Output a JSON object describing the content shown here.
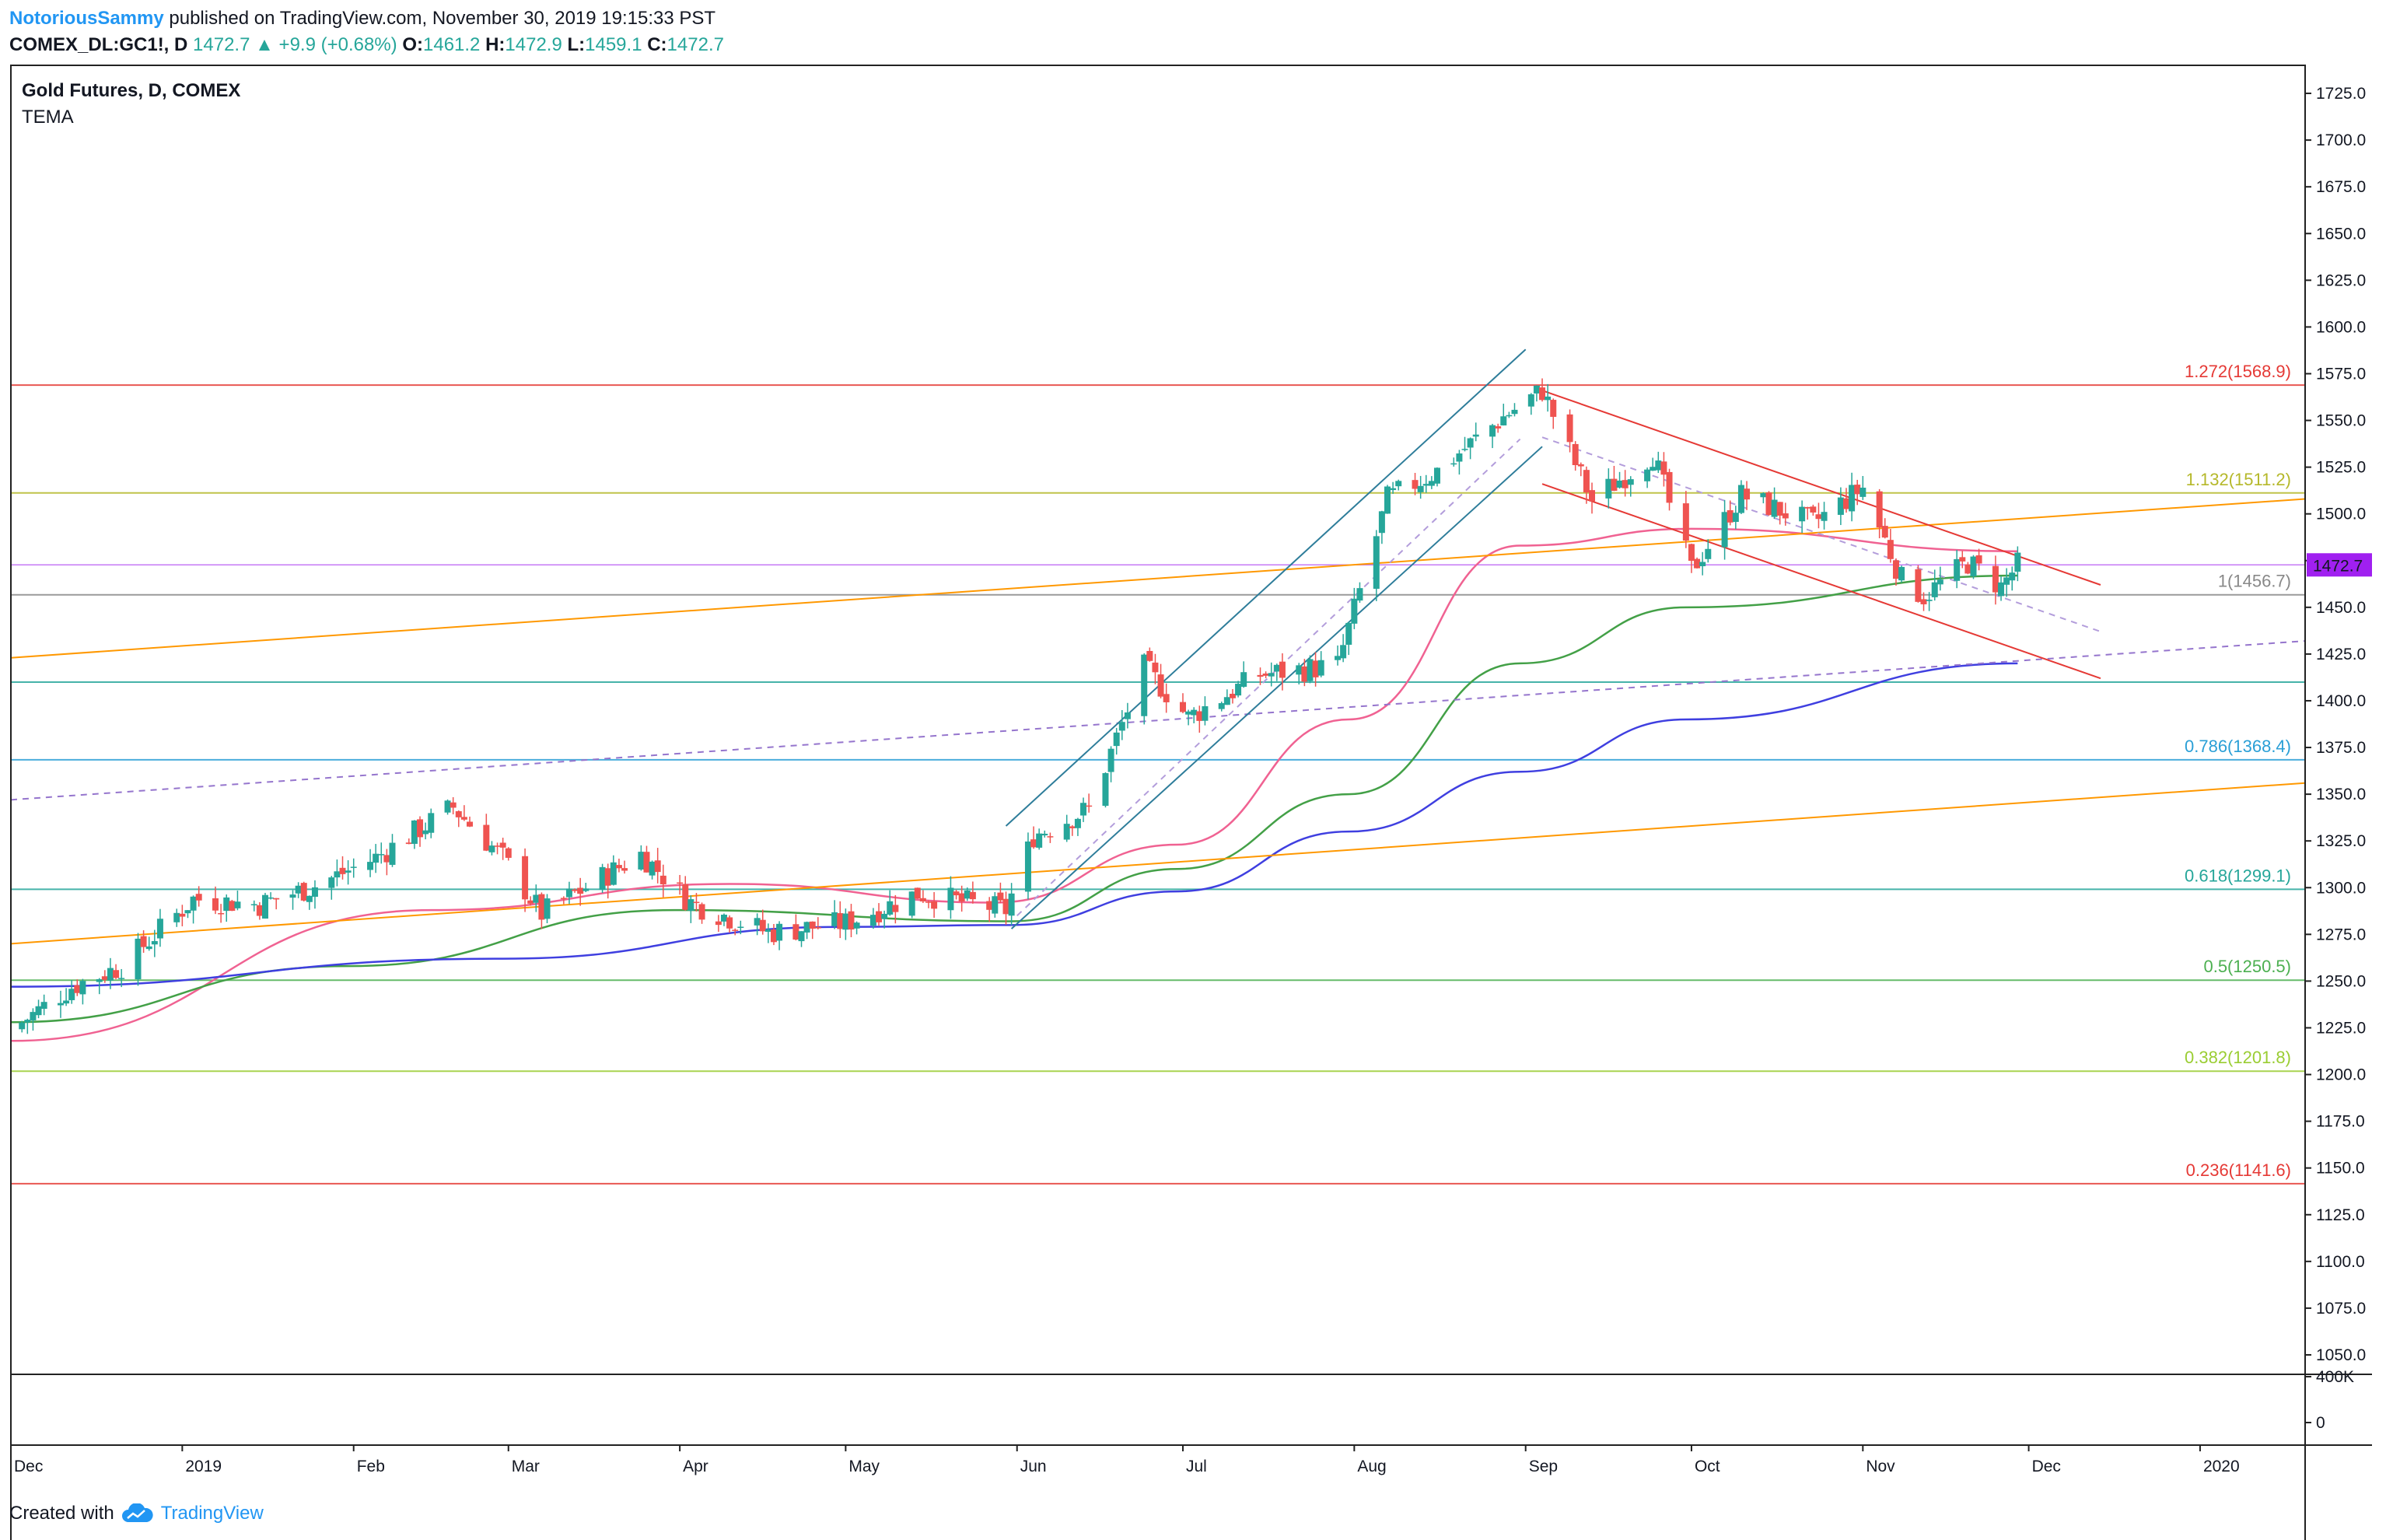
{
  "header": {
    "author": "NotoriousSammy",
    "published_text": "published on TradingView.com, November 30, 2019 19:15:33 PST",
    "symbol": "COMEX_DL:GC1!, D",
    "last": "1472.7",
    "change_arrow": "▲",
    "change": "+9.9 (+0.68%)",
    "o_label": "O:",
    "o_value": "1461.2",
    "h_label": "H:",
    "h_value": "1472.9",
    "l_label": "L:",
    "l_value": "1459.1",
    "c_label": "C:",
    "c_value": "1472.7"
  },
  "legend": {
    "title": "Gold Futures, D, COMEX",
    "indicator": "TEMA"
  },
  "footer": {
    "created_with": "Created with",
    "brand": "TradingView"
  },
  "price_badge": {
    "text": "1472.7",
    "color": "#a020f0"
  },
  "chart_data": {
    "type": "candlestick",
    "x_axis": {
      "ticks": [
        "Dec",
        "2019",
        "Feb",
        "Mar",
        "Apr",
        "May",
        "Jun",
        "Jul",
        "Aug",
        "Sep",
        "Oct",
        "Nov",
        "Dec",
        "2020"
      ],
      "range": [
        "2018-12-01",
        "2020-01-20"
      ]
    },
    "y_axis": {
      "range": [
        1040,
        1740
      ],
      "ticks": [
        "1725.0",
        "1700.0",
        "1675.0",
        "1650.0",
        "1625.0",
        "1600.0",
        "1575.0",
        "1550.0",
        "1525.0",
        "1500.0",
        "1475.0",
        "1450.0",
        "1425.0",
        "1400.0",
        "1375.0",
        "1350.0",
        "1325.0",
        "1300.0",
        "1275.0",
        "1250.0",
        "1225.0",
        "1200.0",
        "1175.0",
        "1150.0",
        "1125.0",
        "1100.0",
        "1075.0",
        "1050.0"
      ]
    },
    "volume_axis_ticks": [
      "400K",
      "0"
    ],
    "colors": {
      "up": "#26a69a",
      "down": "#ef5350"
    },
    "price_path": [
      {
        "date": "2018-12-03",
        "close": 1228
      },
      {
        "date": "2018-12-12",
        "close": 1247
      },
      {
        "date": "2018-12-21",
        "close": 1258
      },
      {
        "date": "2019-01-03",
        "close": 1294
      },
      {
        "date": "2019-01-15",
        "close": 1291
      },
      {
        "date": "2019-01-25",
        "close": 1301
      },
      {
        "date": "2019-02-05",
        "close": 1316
      },
      {
        "date": "2019-02-19",
        "close": 1343
      },
      {
        "date": "2019-02-28",
        "close": 1316
      },
      {
        "date": "2019-03-07",
        "close": 1286
      },
      {
        "date": "2019-03-25",
        "close": 1318
      },
      {
        "date": "2019-04-03",
        "close": 1292
      },
      {
        "date": "2019-04-17",
        "close": 1276
      },
      {
        "date": "2019-05-01",
        "close": 1281
      },
      {
        "date": "2019-05-14",
        "close": 1297
      },
      {
        "date": "2019-05-30",
        "close": 1288
      },
      {
        "date": "2019-06-04",
        "close": 1328
      },
      {
        "date": "2019-06-14",
        "close": 1342
      },
      {
        "date": "2019-06-24",
        "close": 1418
      },
      {
        "date": "2019-07-02",
        "close": 1391
      },
      {
        "date": "2019-07-15",
        "close": 1414
      },
      {
        "date": "2019-07-29",
        "close": 1419
      },
      {
        "date": "2019-08-07",
        "close": 1508
      },
      {
        "date": "2019-08-16",
        "close": 1523
      },
      {
        "date": "2019-08-28",
        "close": 1552
      },
      {
        "date": "2019-09-04",
        "close": 1566
      },
      {
        "date": "2019-09-13",
        "close": 1507
      },
      {
        "date": "2019-09-24",
        "close": 1532
      },
      {
        "date": "2019-10-01",
        "close": 1470
      },
      {
        "date": "2019-10-10",
        "close": 1510
      },
      {
        "date": "2019-10-23",
        "close": 1495
      },
      {
        "date": "2019-11-01",
        "close": 1514
      },
      {
        "date": "2019-11-08",
        "close": 1465
      },
      {
        "date": "2019-11-12",
        "close": 1456
      },
      {
        "date": "2019-11-20",
        "close": 1474
      },
      {
        "date": "2019-11-26",
        "close": 1461
      },
      {
        "date": "2019-11-29",
        "close": 1472.7
      }
    ],
    "moving_averages": [
      {
        "color": "#f06292",
        "points": [
          {
            "date": "2018-12-01",
            "value": 1218
          },
          {
            "date": "2019-02-15",
            "value": 1288
          },
          {
            "date": "2019-04-10",
            "value": 1302
          },
          {
            "date": "2019-05-28",
            "value": 1292
          },
          {
            "date": "2019-06-30",
            "value": 1323
          },
          {
            "date": "2019-07-31",
            "value": 1390
          },
          {
            "date": "2019-08-31",
            "value": 1483
          },
          {
            "date": "2019-10-01",
            "value": 1492
          },
          {
            "date": "2019-11-29",
            "value": 1480
          }
        ]
      },
      {
        "color": "#43a047",
        "points": [
          {
            "date": "2018-12-01",
            "value": 1228
          },
          {
            "date": "2019-01-31",
            "value": 1258
          },
          {
            "date": "2019-03-31",
            "value": 1288
          },
          {
            "date": "2019-05-31",
            "value": 1282
          },
          {
            "date": "2019-06-30",
            "value": 1310
          },
          {
            "date": "2019-07-31",
            "value": 1350
          },
          {
            "date": "2019-08-31",
            "value": 1420
          },
          {
            "date": "2019-09-30",
            "value": 1450
          },
          {
            "date": "2019-11-29",
            "value": 1467
          }
        ]
      },
      {
        "color": "#3f3fe0",
        "points": [
          {
            "date": "2018-12-01",
            "value": 1247
          },
          {
            "date": "2019-02-28",
            "value": 1262
          },
          {
            "date": "2019-04-30",
            "value": 1279
          },
          {
            "date": "2019-05-31",
            "value": 1280
          },
          {
            "date": "2019-06-30",
            "value": 1298
          },
          {
            "date": "2019-07-31",
            "value": 1330
          },
          {
            "date": "2019-08-31",
            "value": 1362
          },
          {
            "date": "2019-09-30",
            "value": 1390
          },
          {
            "date": "2019-11-29",
            "value": 1420
          }
        ]
      }
    ],
    "fib_levels": [
      {
        "label": "1.272(1568.9)",
        "value": 1568.9,
        "color": "#e53935"
      },
      {
        "label": "1.132(1511.2)",
        "value": 1511.2,
        "color": "#b5b82a"
      },
      {
        "label": "1(1456.7)",
        "value": 1456.7,
        "color": "#888888"
      },
      {
        "label": "",
        "value": 1410,
        "color": "#26a69a"
      },
      {
        "label": "0.786(1368.4)",
        "value": 1368.4,
        "color": "#2a9fd6"
      },
      {
        "label": "0.618(1299.1)",
        "value": 1299.1,
        "color": "#26a69a"
      },
      {
        "label": "0.5(1250.5)",
        "value": 1250.5,
        "color": "#4caf50"
      },
      {
        "label": "0.382(1201.8)",
        "value": 1201.8,
        "color": "#9acd32"
      },
      {
        "label": "0.236(1141.6)",
        "value": 1141.6,
        "color": "#e53935"
      }
    ],
    "current_price": 1472.7,
    "trendlines": [
      {
        "color": "#ff9800",
        "style": "solid",
        "from": {
          "date": "2018-12-01",
          "value": 1423
        },
        "to": {
          "date": "2020-01-20",
          "value": 1508
        }
      },
      {
        "color": "#ff9800",
        "style": "solid",
        "from": {
          "date": "2018-12-01",
          "value": 1270
        },
        "to": {
          "date": "2020-01-20",
          "value": 1356
        }
      },
      {
        "color": "#9575cd",
        "style": "dashed",
        "from": {
          "date": "2018-12-01",
          "value": 1347
        },
        "to": {
          "date": "2020-01-20",
          "value": 1432
        }
      },
      {
        "color": "#2e7d9a",
        "style": "solid",
        "from": {
          "date": "2019-05-30",
          "value": 1333
        },
        "to": {
          "date": "2019-09-01",
          "value": 1588
        }
      },
      {
        "color": "#2e7d9a",
        "style": "solid",
        "from": {
          "date": "2019-05-31",
          "value": 1278
        },
        "to": {
          "date": "2019-09-04",
          "value": 1536
        }
      },
      {
        "color": "#b39ddb",
        "style": "dashed",
        "from": {
          "date": "2019-06-01",
          "value": 1285
        },
        "to": {
          "date": "2019-08-31",
          "value": 1540
        }
      },
      {
        "color": "#e53935",
        "style": "solid",
        "from": {
          "date": "2019-09-04",
          "value": 1566
        },
        "to": {
          "date": "2019-12-14",
          "value": 1462
        }
      },
      {
        "color": "#e53935",
        "style": "solid",
        "from": {
          "date": "2019-09-04",
          "value": 1516
        },
        "to": {
          "date": "2019-12-14",
          "value": 1412
        }
      },
      {
        "color": "#b39ddb",
        "style": "dashed",
        "from": {
          "date": "2019-09-04",
          "value": 1541
        },
        "to": {
          "date": "2019-12-14",
          "value": 1437
        }
      }
    ]
  }
}
